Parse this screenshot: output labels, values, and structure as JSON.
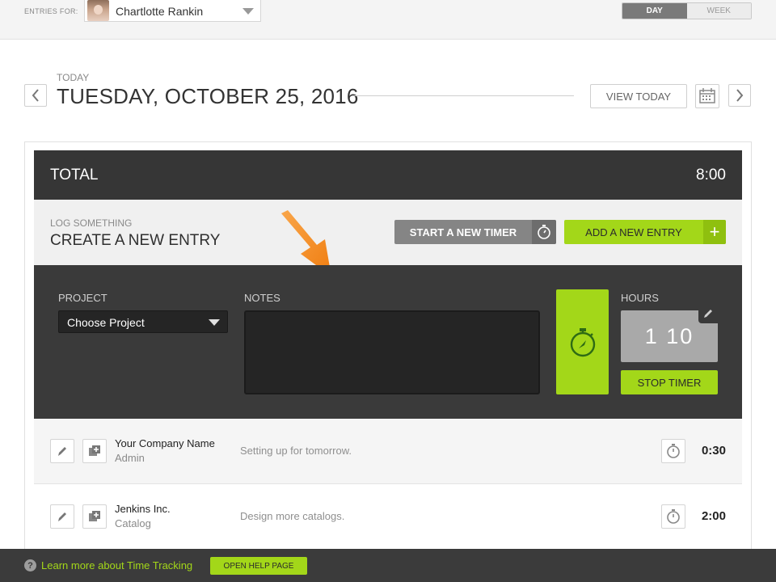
{
  "topbar": {
    "entries_for_label": "ENTRIES FOR:",
    "user_name": "Chartlotte Rankin",
    "view_toggle": {
      "day_label": "DAY",
      "week_label": "WEEK",
      "selected": "DAY"
    }
  },
  "date_header": {
    "today_label": "TODAY",
    "date_title": "TUESDAY, OCTOBER 25, 2016",
    "view_today_label": "VIEW TODAY"
  },
  "total": {
    "label": "TOTAL",
    "value": "8:00"
  },
  "log": {
    "small_label": "LOG SOMETHING",
    "title": "CREATE A NEW ENTRY",
    "start_timer_label": "START A NEW TIMER",
    "add_entry_label": "ADD A NEW ENTRY"
  },
  "form": {
    "project_label": "PROJECT",
    "project_value": "Choose Project",
    "notes_label": "NOTES",
    "notes_value": "",
    "hours_label": "HOURS",
    "hours_value": "1 10",
    "stop_timer_label": "STOP TIMER"
  },
  "entries": [
    {
      "client": "Your Company Name",
      "task": "Admin",
      "notes": "Setting up for tomorrow.",
      "time": "0:30"
    },
    {
      "client": "Jenkins Inc.",
      "task": "Catalog",
      "notes": "Design more catalogs.",
      "time": "2:00"
    }
  ],
  "help": {
    "question_mark": "?",
    "link_text": "Learn more about Time Tracking",
    "button_label": "OPEN HELP PAGE"
  },
  "colors": {
    "accent_green": "#a3d719",
    "dark_panel": "#363636",
    "arrow_orange": "#f58220"
  }
}
